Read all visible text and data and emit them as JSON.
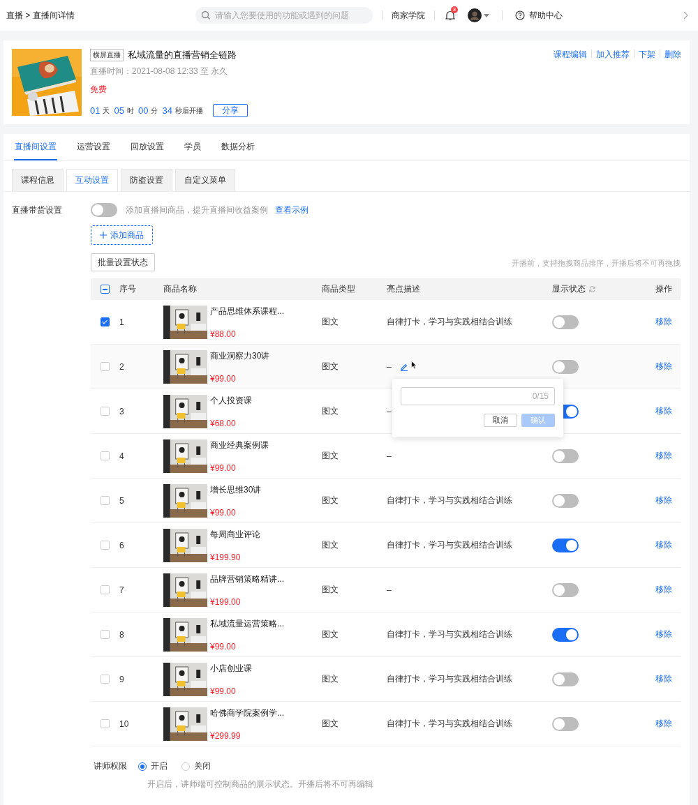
{
  "topbar": {
    "breadcrumb": "直播 > 直播间详情",
    "search_placeholder": "请输入您要使用的功能或遇到的问题",
    "academy": "商家学院",
    "notification_count": "3",
    "help": "帮助中心"
  },
  "course": {
    "badge": "横屏直播",
    "title": "私域流量的直播营销全链路",
    "time": "直播时间：2021-08-08 12:33 至 永久",
    "price": "免费",
    "countdown": [
      {
        "value": "01",
        "unit": "天"
      },
      {
        "value": "05",
        "unit": "时"
      },
      {
        "value": "00",
        "unit": "分"
      },
      {
        "value": "34",
        "unit": "秒后开播"
      }
    ],
    "share": "分享",
    "actions": [
      "课程编辑",
      "加入推荐",
      "下架",
      "删除"
    ]
  },
  "main_tabs": [
    {
      "label": "直播间设置",
      "selected": true
    },
    {
      "label": "运营设置",
      "selected": false
    },
    {
      "label": "回放设置",
      "selected": false
    },
    {
      "label": "学员",
      "selected": false
    },
    {
      "label": "数据分析",
      "selected": false
    }
  ],
  "sub_tabs": [
    {
      "label": "课程信息",
      "selected": false
    },
    {
      "label": "互动设置",
      "selected": true
    },
    {
      "label": "防盗设置",
      "selected": false
    },
    {
      "label": "自定义菜单",
      "selected": false
    }
  ],
  "selling": {
    "label": "直播带货设置",
    "on": false,
    "hint": "添加直播间商品，提升直播间收益案例",
    "link": "查看示例",
    "add_button": "添加商品",
    "batch_button": "批量设置状态",
    "drag_hint": "开播前，支持拖拽商品排序，开播后将不可再拖拽"
  },
  "table": {
    "select_all_indeterminate": true,
    "columns": [
      "序号",
      "商品名称",
      "商品类型",
      "亮点描述",
      "显示状态",
      "操作"
    ],
    "rows": [
      {
        "no": "1",
        "name": "产品思维体系课程...",
        "price": "¥88.00",
        "type": "图文",
        "desc": "自律打卡，学习与实践相结合训练",
        "checked": true,
        "on": false,
        "action": "移除"
      },
      {
        "no": "2",
        "name": "商业洞察力30讲",
        "price": "¥99.00",
        "type": "图文",
        "desc": "–",
        "checked": false,
        "on": false,
        "action": "移除",
        "edit_popover": {
          "counter": "0/15",
          "cancel": "取消",
          "confirm": "确认",
          "confirm_disabled": true
        }
      },
      {
        "no": "3",
        "name": "个人投资课",
        "price": "¥68.00",
        "type": "图文",
        "desc": "–",
        "checked": false,
        "on": true,
        "action": "移除"
      },
      {
        "no": "4",
        "name": "商业经典案例课",
        "price": "¥99.00",
        "type": "图文",
        "desc": "–",
        "checked": false,
        "on": false,
        "action": "移除"
      },
      {
        "no": "5",
        "name": "增长思维30讲",
        "price": "¥99.00",
        "type": "图文",
        "desc": "自律打卡，学习与实践相结合训练",
        "checked": false,
        "on": false,
        "action": "移除"
      },
      {
        "no": "6",
        "name": "每周商业评论",
        "price": "¥199.90",
        "type": "图文",
        "desc": "自律打卡，学习与实践相结合训练",
        "checked": false,
        "on": true,
        "action": "移除"
      },
      {
        "no": "7",
        "name": "品牌营销策略精讲...",
        "price": "¥199.00",
        "type": "图文",
        "desc": "–",
        "checked": false,
        "on": false,
        "action": "移除"
      },
      {
        "no": "8",
        "name": "私域流量运营策略...",
        "price": "¥99.00",
        "type": "图文",
        "desc": "自律打卡，学习与实践相结合训练",
        "checked": false,
        "on": true,
        "action": "移除"
      },
      {
        "no": "9",
        "name": "小店创业课",
        "price": "¥99.00",
        "type": "图文",
        "desc": "自律打卡，学习与实践相结合训练",
        "checked": false,
        "on": false,
        "action": "移除"
      },
      {
        "no": "10",
        "name": "哈佛商学院案例学...",
        "price": "¥299.99",
        "type": "图文",
        "desc": "自律打卡，学习与实践相结合训练",
        "checked": false,
        "on": false,
        "action": "移除"
      }
    ]
  },
  "lecturer": {
    "label": "讲师权限",
    "options": [
      {
        "label": "开启",
        "selected": true
      },
      {
        "label": "关闭",
        "selected": false
      }
    ],
    "note": "开启后，讲师端可控制商品的展示状态。开播后将不可再编辑"
  }
}
